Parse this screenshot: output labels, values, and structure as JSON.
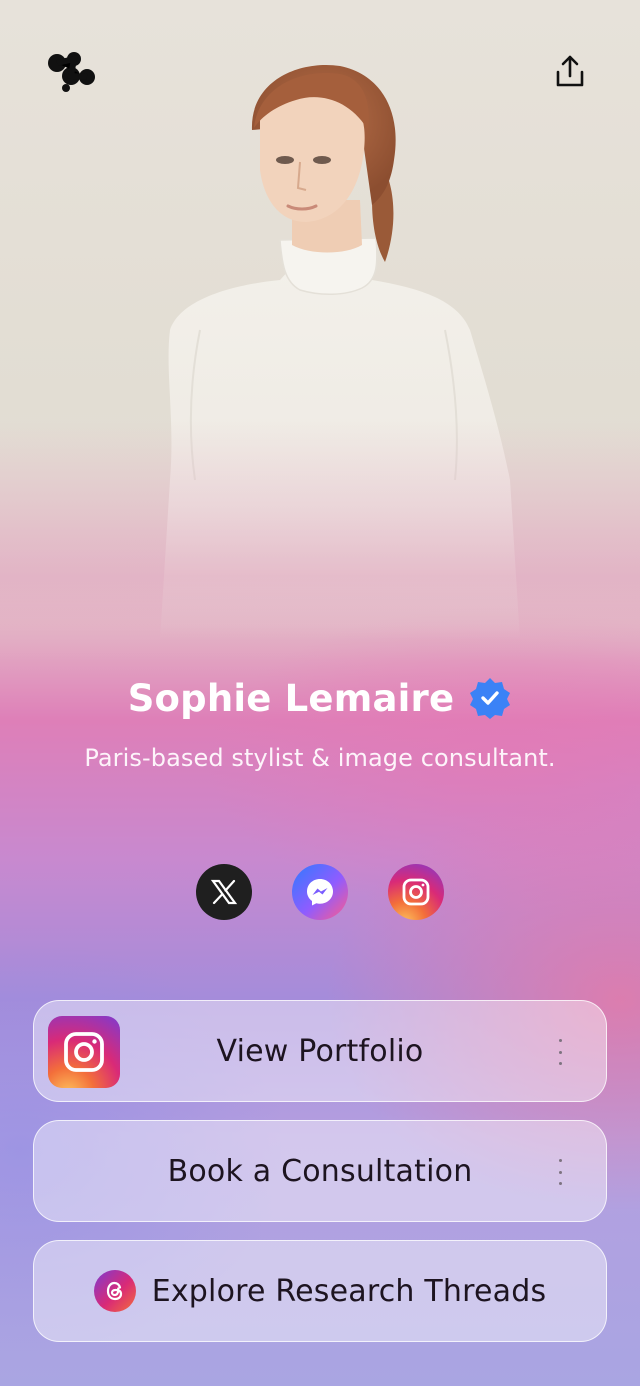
{
  "profile": {
    "name": "Sophie Lemaire",
    "bio": "Paris-based stylist & image consultant.",
    "verified": true
  },
  "header": {
    "logo_icon": "linktree-blob-logo-icon",
    "share_icon": "share-upload-icon"
  },
  "socials": [
    {
      "name": "x-icon"
    },
    {
      "name": "messenger-icon"
    },
    {
      "name": "instagram-icon"
    }
  ],
  "links": {
    "portfolio": {
      "label": "View Portfolio",
      "icon": "instagram-icon"
    },
    "consultation": {
      "label": "Book a Consultation"
    },
    "threads": {
      "label": "Explore Research Threads",
      "icon": "threads-icon"
    }
  },
  "colors": {
    "badge": "#3b82f6",
    "accent_pink": "#de7fb8",
    "accent_purple": "#a58cda"
  }
}
